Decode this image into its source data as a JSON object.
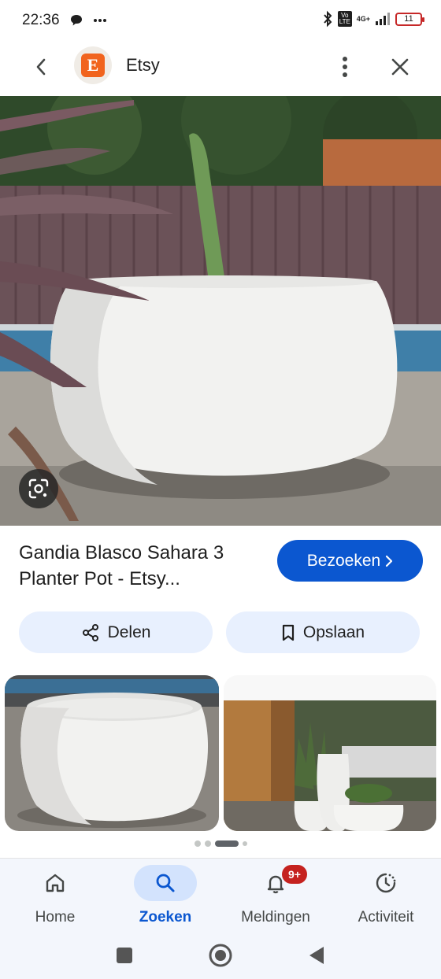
{
  "status_bar": {
    "time": "22:36",
    "network_top": "4G+",
    "network_volte": "Vo LTE",
    "battery": "11"
  },
  "app_bar": {
    "site_logo_letter": "E",
    "site_title": "Etsy"
  },
  "result": {
    "title": "Gandia Blasco Sahara 3 Planter Pot - Etsy...",
    "visit_label": "Bezoeken",
    "share_label": "Delen",
    "save_label": "Opslaan"
  },
  "carousel": {
    "dot_count": 4,
    "active_index": 2
  },
  "bottom_nav": {
    "items": [
      {
        "label": "Home",
        "icon": "home-icon",
        "active": false
      },
      {
        "label": "Zoeken",
        "icon": "search-icon",
        "active": true
      },
      {
        "label": "Meldingen",
        "icon": "bell-icon",
        "active": false,
        "badge": "9+"
      },
      {
        "label": "Activiteit",
        "icon": "activity-icon",
        "active": false
      }
    ]
  },
  "colors": {
    "accent": "#0b57d0",
    "chip_bg": "#e8f0fe",
    "etsy_orange": "#f1641e",
    "badge_red": "#c5221f"
  }
}
